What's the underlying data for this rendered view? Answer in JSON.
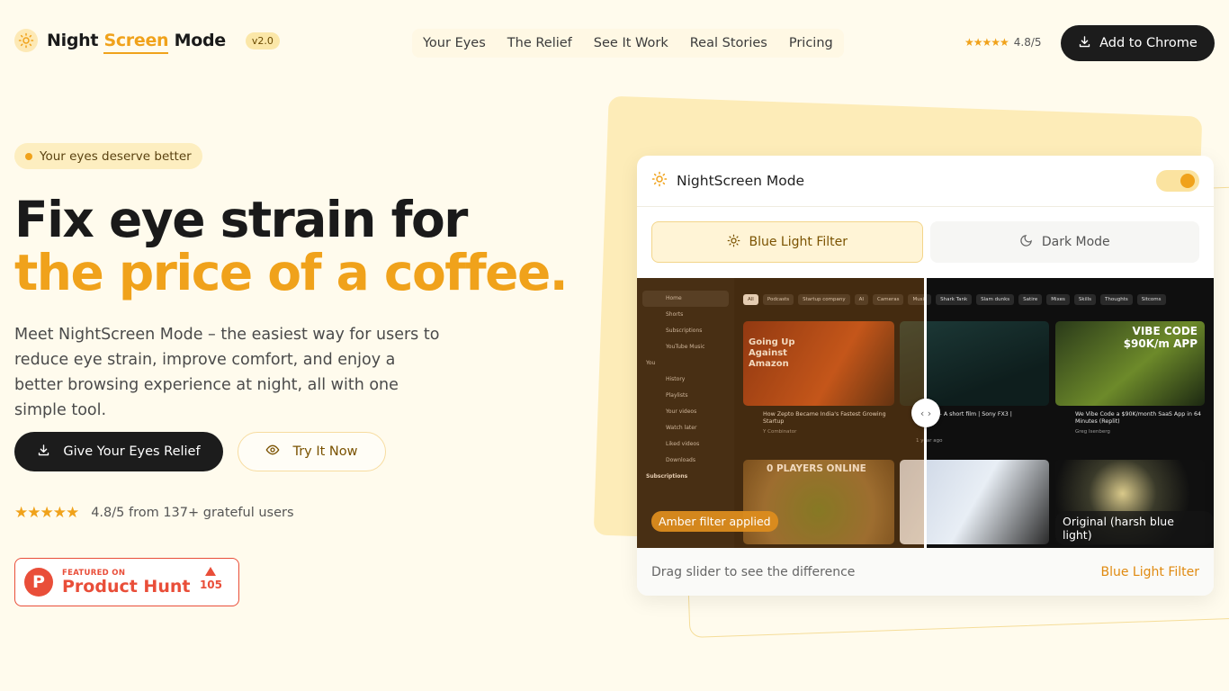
{
  "header": {
    "brand_pre": "Night",
    "brand_mid": "Screen",
    "brand_post": "Mode",
    "version": "v2.0",
    "nav": [
      "Your Eyes",
      "The Relief",
      "See It Work",
      "Real Stories",
      "Pricing"
    ],
    "rating": "4.8/5",
    "cta": "Add to Chrome"
  },
  "hero": {
    "badge": "Your eyes deserve better",
    "title_line1": "Fix eye strain for",
    "title_line2": "the price of a coffee.",
    "lead": "Meet NightScreen Mode – the easiest way for users to reduce eye strain, improve comfort, and enjoy a better browsing experience at night, all with one simple tool.",
    "primary_cta": "Give Your Eyes Relief",
    "secondary_cta": "Try It Now",
    "rating_text": "4.8/5 from 137+ grateful users",
    "producthunt": {
      "small": "FEATURED ON",
      "big": "Product Hunt",
      "votes": "105"
    }
  },
  "demo": {
    "title": "NightScreen Mode",
    "tabs": [
      "Blue Light Filter",
      "Dark Mode"
    ],
    "label_left": "Amber filter applied",
    "label_right": "Original (harsh blue light)",
    "footer_hint": "Drag slider to see the difference",
    "footer_mode": "Blue Light Filter",
    "screenshot": {
      "sidebar": [
        "Home",
        "Shorts",
        "Subscriptions",
        "YouTube Music",
        "You",
        "History",
        "Playlists",
        "Your videos",
        "Watch later",
        "Liked videos",
        "Downloads",
        "Subscriptions"
      ],
      "chips": [
        "All",
        "Podcasts",
        "Startup company",
        "AI",
        "Cameras",
        "Music",
        "Shark Tank",
        "Slam dunks",
        "Satire",
        "Mixes",
        "Skills",
        "Thoughts",
        "Sitcoms"
      ],
      "videos": [
        {
          "title": "How Zepto Became India's Fastest Growing Startup",
          "meta": "Y Combinator",
          "thumb_text": "Going Up Against Amazon"
        },
        {
          "title": "COFFEE - A short film | Sony FX3 |",
          "meta": "1 year ago",
          "thumb_text": ""
        },
        {
          "title": "We Vibe Code a $90K/month SaaS App in 64 Minutes (Replit)",
          "meta": "Greg Isenberg",
          "thumb_text": "VIBE CODE $90K/m APP"
        },
        {
          "title": "",
          "meta": "",
          "thumb_text": "0 PLAYERS ONLINE"
        }
      ]
    }
  },
  "colors": {
    "accent": "#f0a21b",
    "dark": "#1c1c1c",
    "bg": "#fffbed",
    "producthunt": "#e94e39"
  }
}
